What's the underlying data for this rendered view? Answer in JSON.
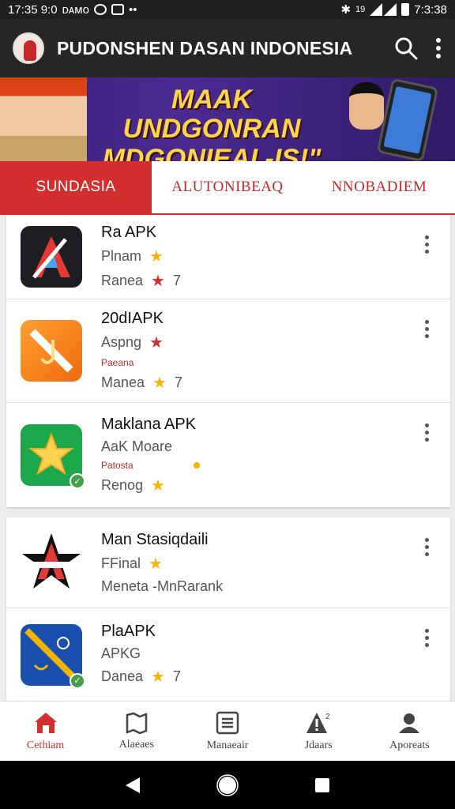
{
  "status_bar": {
    "time_left": "17:35 9:0",
    "carrier": "ᴅᴀᴍᴏ",
    "time_right": "7:3:38",
    "battery_label": "19"
  },
  "app": {
    "title": "PUDONSHEN DASAN INDONESIA"
  },
  "banner": {
    "line1": "MAAK UNDGONRAN",
    "line2": "MDGONIEAI -IS!\""
  },
  "tabs": [
    {
      "label": "SUNDASIA",
      "active": true
    },
    {
      "label": "ALUTONIBEAQ",
      "active": false
    },
    {
      "label": "NNOBADIEM",
      "active": false
    }
  ],
  "list": [
    {
      "name": "Ra APK",
      "line1": "Plnam",
      "line2": "Ranea",
      "rating": "7"
    },
    {
      "name": "20dIAPK",
      "line1": "Aspng",
      "small": "Paeana",
      "line2": "Manea",
      "rating": "7"
    },
    {
      "name": "Maklana APK",
      "line1": "AaK Moare",
      "small": "Patosta",
      "line2": "Renog",
      "rating": ""
    },
    {
      "name": "Man Stasiqdaili",
      "line1": "FFinal",
      "line2": "Meneta -MnRarank",
      "rating": ""
    },
    {
      "name": "PlaAPK",
      "line1": "APKG",
      "line2": "Danea",
      "rating": "7"
    }
  ],
  "bottom_nav": [
    {
      "label": "Cethiam",
      "icon": "home-icon"
    },
    {
      "label": "Alaeaes",
      "icon": "map-icon"
    },
    {
      "label": "Manaeair",
      "icon": "list-icon"
    },
    {
      "label": "Jdaars",
      "icon": "alert-icon"
    },
    {
      "label": "Aporeats",
      "icon": "person-icon"
    }
  ],
  "colors": {
    "accent": "#d32f2f",
    "appbar": "#262626",
    "star": "#f2b705"
  }
}
